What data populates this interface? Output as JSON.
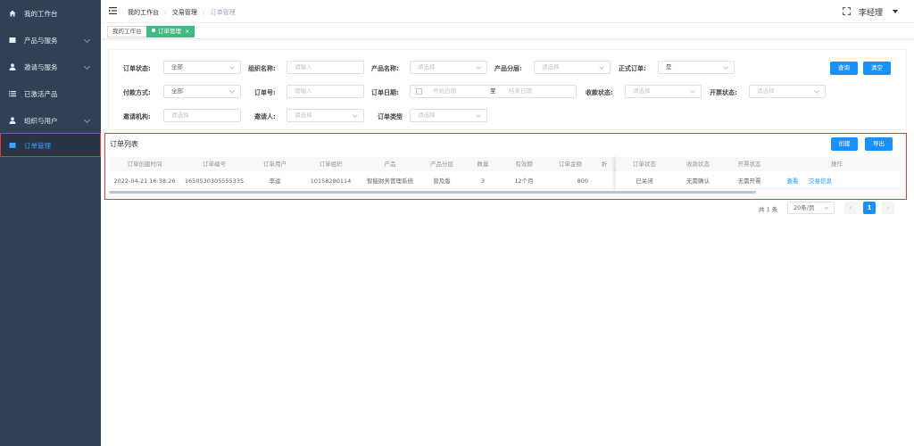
{
  "sidebar": {
    "items": [
      {
        "label": "我的工作台",
        "icon": "home-icon"
      },
      {
        "label": "产品与服务",
        "icon": "folder-icon"
      },
      {
        "label": "邀请与服务",
        "icon": "user-icon"
      },
      {
        "label": "已激活产品",
        "icon": "list-icon"
      },
      {
        "label": "组织与用户",
        "icon": "user-icon"
      },
      {
        "label": "订单管理",
        "icon": "folder-icon"
      }
    ]
  },
  "header": {
    "breadcrumb": [
      "我的工作台",
      "交易管理",
      "订单管理"
    ],
    "separator": "/",
    "user_name": "李经理"
  },
  "tags": [
    "我的工作台",
    "订单管理"
  ],
  "filters": {
    "order_status": {
      "label": "订单状态:",
      "value": "全部"
    },
    "org_name": {
      "label": "组织名称:",
      "placeholder": "请输入"
    },
    "product_name": {
      "label": "产品名称:",
      "placeholder": "请选择"
    },
    "product_tier": {
      "label": "产品分层:",
      "placeholder": "请选择"
    },
    "formal_order": {
      "label": "正式订单:",
      "value": "是"
    },
    "payment": {
      "label": "付款方式:",
      "value": "全部"
    },
    "order_no": {
      "label": "订单号:",
      "placeholder": "请输入"
    },
    "order_date": {
      "label": "订单日期:",
      "start": "开始日期",
      "to": "至",
      "end": "结束日期"
    },
    "collect_status": {
      "label": "收款状态:",
      "placeholder": "请选择"
    },
    "invoice_status": {
      "label": "开票状态:",
      "placeholder": "请选择"
    },
    "invite_org": {
      "label": "邀请机构:",
      "placeholder": "请选择"
    },
    "inviter": {
      "label": "邀请人:",
      "placeholder": "请选择"
    },
    "order_type": {
      "label": "订单类型",
      "placeholder": "请选择"
    },
    "query_label": "查询",
    "clear_label": "清空"
  },
  "list": {
    "title": "订单列表",
    "create_label": "创建",
    "export_label": "导出",
    "columns": [
      "订单创建时间",
      "订单编号",
      "订单用户",
      "订单组织",
      "产品",
      "产品分层",
      "数量",
      "有效期",
      "订单金额",
      "折",
      "订单状态",
      "收款状态",
      "开票状态",
      "操作"
    ],
    "rows": [
      {
        "created": "2022-04-21 16:38:26",
        "order_no": "1650530305555335",
        "user": "李逵",
        "org": "10158280114",
        "product": "智能财务管理系统",
        "tier": "普及版",
        "qty": "3",
        "validity": "12个月",
        "amount": "800",
        "status": "已关闭",
        "collect": "无需确认",
        "invoice": "无需开票",
        "action_view": "查看",
        "action_trade": "交易信息"
      }
    ]
  },
  "pager": {
    "total": "共 1 条",
    "page_size": "20条/页",
    "current_page": "1"
  },
  "colors": {
    "sidebar_bg": "#304156",
    "primary": "#1890ff",
    "tag_active": "#42b983",
    "highlight": "#e23b3b"
  }
}
